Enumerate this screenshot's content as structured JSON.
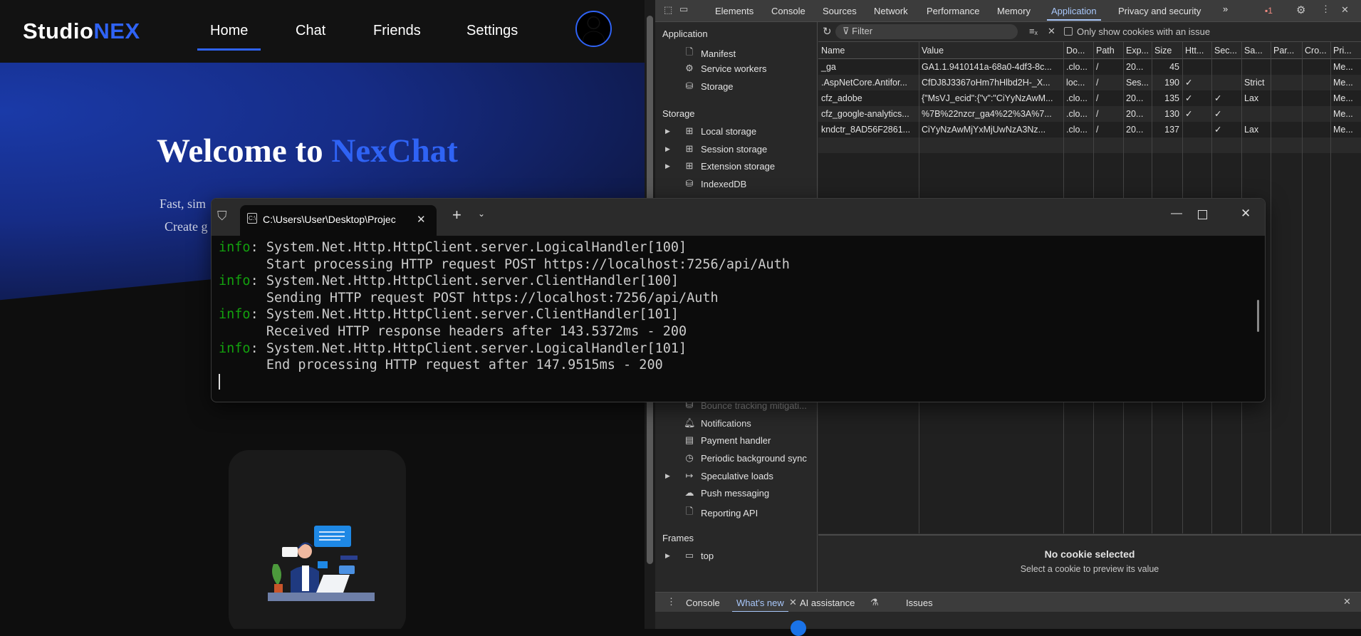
{
  "site": {
    "logo_a": "Studio",
    "logo_b": "NEX",
    "nav": [
      "Home",
      "Chat",
      "Friends",
      "Settings"
    ],
    "welcome_a": "Welcome to ",
    "welcome_b": "NexChat",
    "sub1": "Fast, sim",
    "sub2": "Create g",
    "accent": "#2f63f5"
  },
  "devtools": {
    "tabs": [
      "Elements",
      "Console",
      "Sources",
      "Network",
      "Performance",
      "Memory",
      "Application",
      "Privacy and security"
    ],
    "more": "»",
    "issues_count": "1",
    "sidebar": {
      "application_heading": "Application",
      "application_items": [
        "Manifest",
        "Service workers",
        "Storage"
      ],
      "storage_heading": "Storage",
      "storage_items": [
        "Local storage",
        "Session storage",
        "Extension storage",
        "IndexedDB"
      ],
      "lower_items": [
        "Bounce tracking mitigati...",
        "Notifications",
        "Payment handler",
        "Periodic background sync",
        "Speculative loads",
        "Push messaging",
        "Reporting API"
      ],
      "frames_heading": "Frames",
      "frames_items": [
        "top"
      ]
    },
    "toolbar": {
      "filter_placeholder": "Filter",
      "only_issues_label": "Only show cookies with an issue"
    },
    "cookies": {
      "headers": [
        "Name",
        "Value",
        "Do...",
        "Path",
        "Exp...",
        "Size",
        "Htt...",
        "Sec...",
        "Sa...",
        "Par...",
        "Cro...",
        "Pri..."
      ],
      "rows": [
        [
          "_ga",
          "GA1.1.9410141a-68a0-4df3-8c...",
          ".clo...",
          "/",
          "20...",
          "45",
          "",
          "",
          "",
          "",
          "",
          "Me..."
        ],
        [
          ".AspNetCore.Antifor...",
          "CfDJ8J3367oHm7hHlbd2H-_X...",
          "loc...",
          "/",
          "Ses...",
          "190",
          "✓",
          "",
          "Strict",
          "",
          "",
          "Me..."
        ],
        [
          "cfz_adobe",
          "{\"MsVJ_ecid\":{\"v\":\"CiYyNzAwM...",
          ".clo...",
          "/",
          "20...",
          "135",
          "✓",
          "✓",
          "Lax",
          "",
          "",
          "Me..."
        ],
        [
          "cfz_google-analytics...",
          "%7B%22nzcr_ga4%22%3A%7...",
          ".clo...",
          "/",
          "20...",
          "130",
          "✓",
          "✓",
          "",
          "",
          "",
          "Me..."
        ],
        [
          "kndctr_8AD56F2861...",
          "CiYyNzAwMjYxMjUwNzA3Nz...",
          ".clo...",
          "/",
          "20...",
          "137",
          "",
          "✓",
          "Lax",
          "",
          "",
          "Me..."
        ]
      ]
    },
    "preview": {
      "title": "No cookie selected",
      "hint": "Select a cookie to preview its value"
    },
    "drawer_tabs": [
      "Console",
      "What's new",
      "AI assistance",
      "Issues"
    ]
  },
  "terminal": {
    "tab_title": "C:\\Users\\User\\Desktop\\Projec",
    "lines": [
      {
        "prefix": "info",
        "text": "System.Net.Http.HttpClient.server.LogicalHandler[100]"
      },
      {
        "prefix": "",
        "text": "Start processing HTTP request POST https://localhost:7256/api/Auth"
      },
      {
        "prefix": "info",
        "text": "System.Net.Http.HttpClient.server.ClientHandler[100]"
      },
      {
        "prefix": "",
        "text": "Sending HTTP request POST https://localhost:7256/api/Auth"
      },
      {
        "prefix": "info",
        "text": "System.Net.Http.HttpClient.server.ClientHandler[101]"
      },
      {
        "prefix": "",
        "text": "Received HTTP response headers after 143.5372ms - 200"
      },
      {
        "prefix": "info",
        "text": "System.Net.Http.HttpClient.server.LogicalHandler[101]"
      },
      {
        "prefix": "",
        "text": "End processing HTTP request after 147.9515ms - 200"
      }
    ]
  }
}
